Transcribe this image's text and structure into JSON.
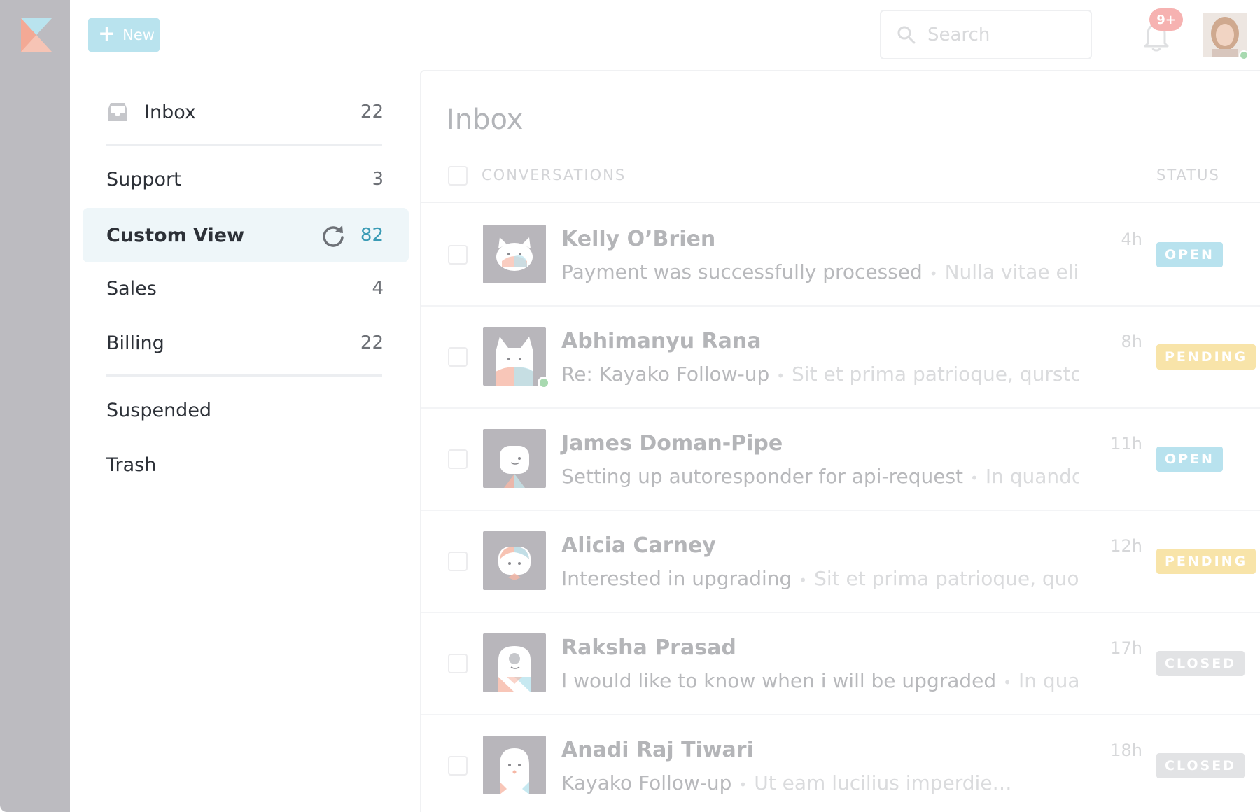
{
  "topbar": {
    "new_button_label": "New",
    "search_placeholder": "Search",
    "notifications_badge": "9+"
  },
  "sidebar": {
    "items": [
      {
        "label": "Inbox",
        "count": "22",
        "icon": "inbox-icon"
      },
      {
        "label": "Support",
        "count": "3"
      },
      {
        "label": "Custom View",
        "count": "82",
        "icon": "refresh-icon",
        "active": true
      },
      {
        "label": "Sales",
        "count": "4"
      },
      {
        "label": "Billing",
        "count": "22"
      },
      {
        "label": "Suspended"
      },
      {
        "label": "Trash"
      }
    ]
  },
  "main": {
    "title": "Inbox",
    "columns": {
      "conversations": "CONVERSATIONS",
      "status": "STATUS"
    },
    "conversations": [
      {
        "name": "Kelly O’Brien",
        "time": "4h",
        "subject": "Payment was successfully processed",
        "preview": "Nulla vitae elite a…",
        "status": "OPEN",
        "online": false
      },
      {
        "name": "Abhimanyu Rana",
        "time": "8h",
        "subject": "Re: Kayako Follow-up",
        "preview": "Sit et prima patrioque, qurstot …",
        "status": "PENDING",
        "online": true
      },
      {
        "name": "James Doman-Pipe",
        "time": "11h",
        "subject": "Setting up autoresponder for api-request",
        "preview": "In quando…",
        "status": "OPEN",
        "online": false
      },
      {
        "name": "Alicia Carney",
        "time": "12h",
        "subject": "Interested in upgrading",
        "preview": "Sit et prima patrioque, quot …",
        "status": "PENDING",
        "online": false
      },
      {
        "name": "Raksha Prasad",
        "time": "17h",
        "subject": "I would like to know when i will be upgraded",
        "preview": "In quan…",
        "status": "CLOSED",
        "online": false
      },
      {
        "name": "Anadi Raj Tiwari",
        "time": "18h",
        "subject": "Kayako Follow-up",
        "preview": "Ut eam lucilius imperdie…",
        "status": "CLOSED",
        "online": false
      }
    ]
  },
  "colors": {
    "rail": "#bcbbc0",
    "accent": "#3a9bb5",
    "open": "#b8e2ee",
    "pending": "#f8e4a9",
    "closed": "#e2e3e5"
  }
}
